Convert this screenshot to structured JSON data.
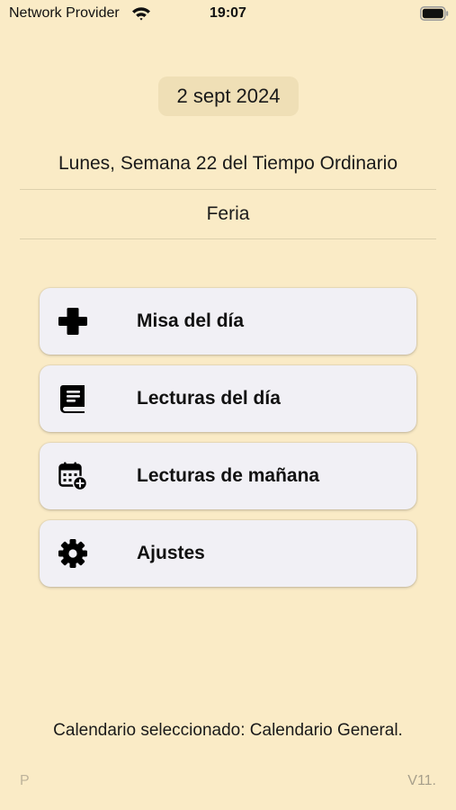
{
  "status_bar": {
    "carrier": "Network Provider",
    "time": "19:07",
    "wifi_icon": "wifi-icon",
    "battery_icon": "battery-full-icon"
  },
  "header": {
    "date": "2 sept 2024",
    "liturgical_day": "Lunes, Semana 22 del Tiempo Ordinario",
    "celebration": "Feria"
  },
  "menu": [
    {
      "label": "Misa del día",
      "icon": "cross-icon"
    },
    {
      "label": "Lecturas del día",
      "icon": "book-icon"
    },
    {
      "label": "Lecturas de mañana",
      "icon": "calendar-plus-icon"
    },
    {
      "label": "Ajustes",
      "icon": "gear-icon"
    }
  ],
  "footer": {
    "calendar_note": "Calendario seleccionado: Calendario General.",
    "left_label": "P",
    "version": "V11."
  },
  "colors": {
    "background": "#faebc6",
    "button_background": "#f1f0f5",
    "date_pill": "#efdfb6"
  }
}
